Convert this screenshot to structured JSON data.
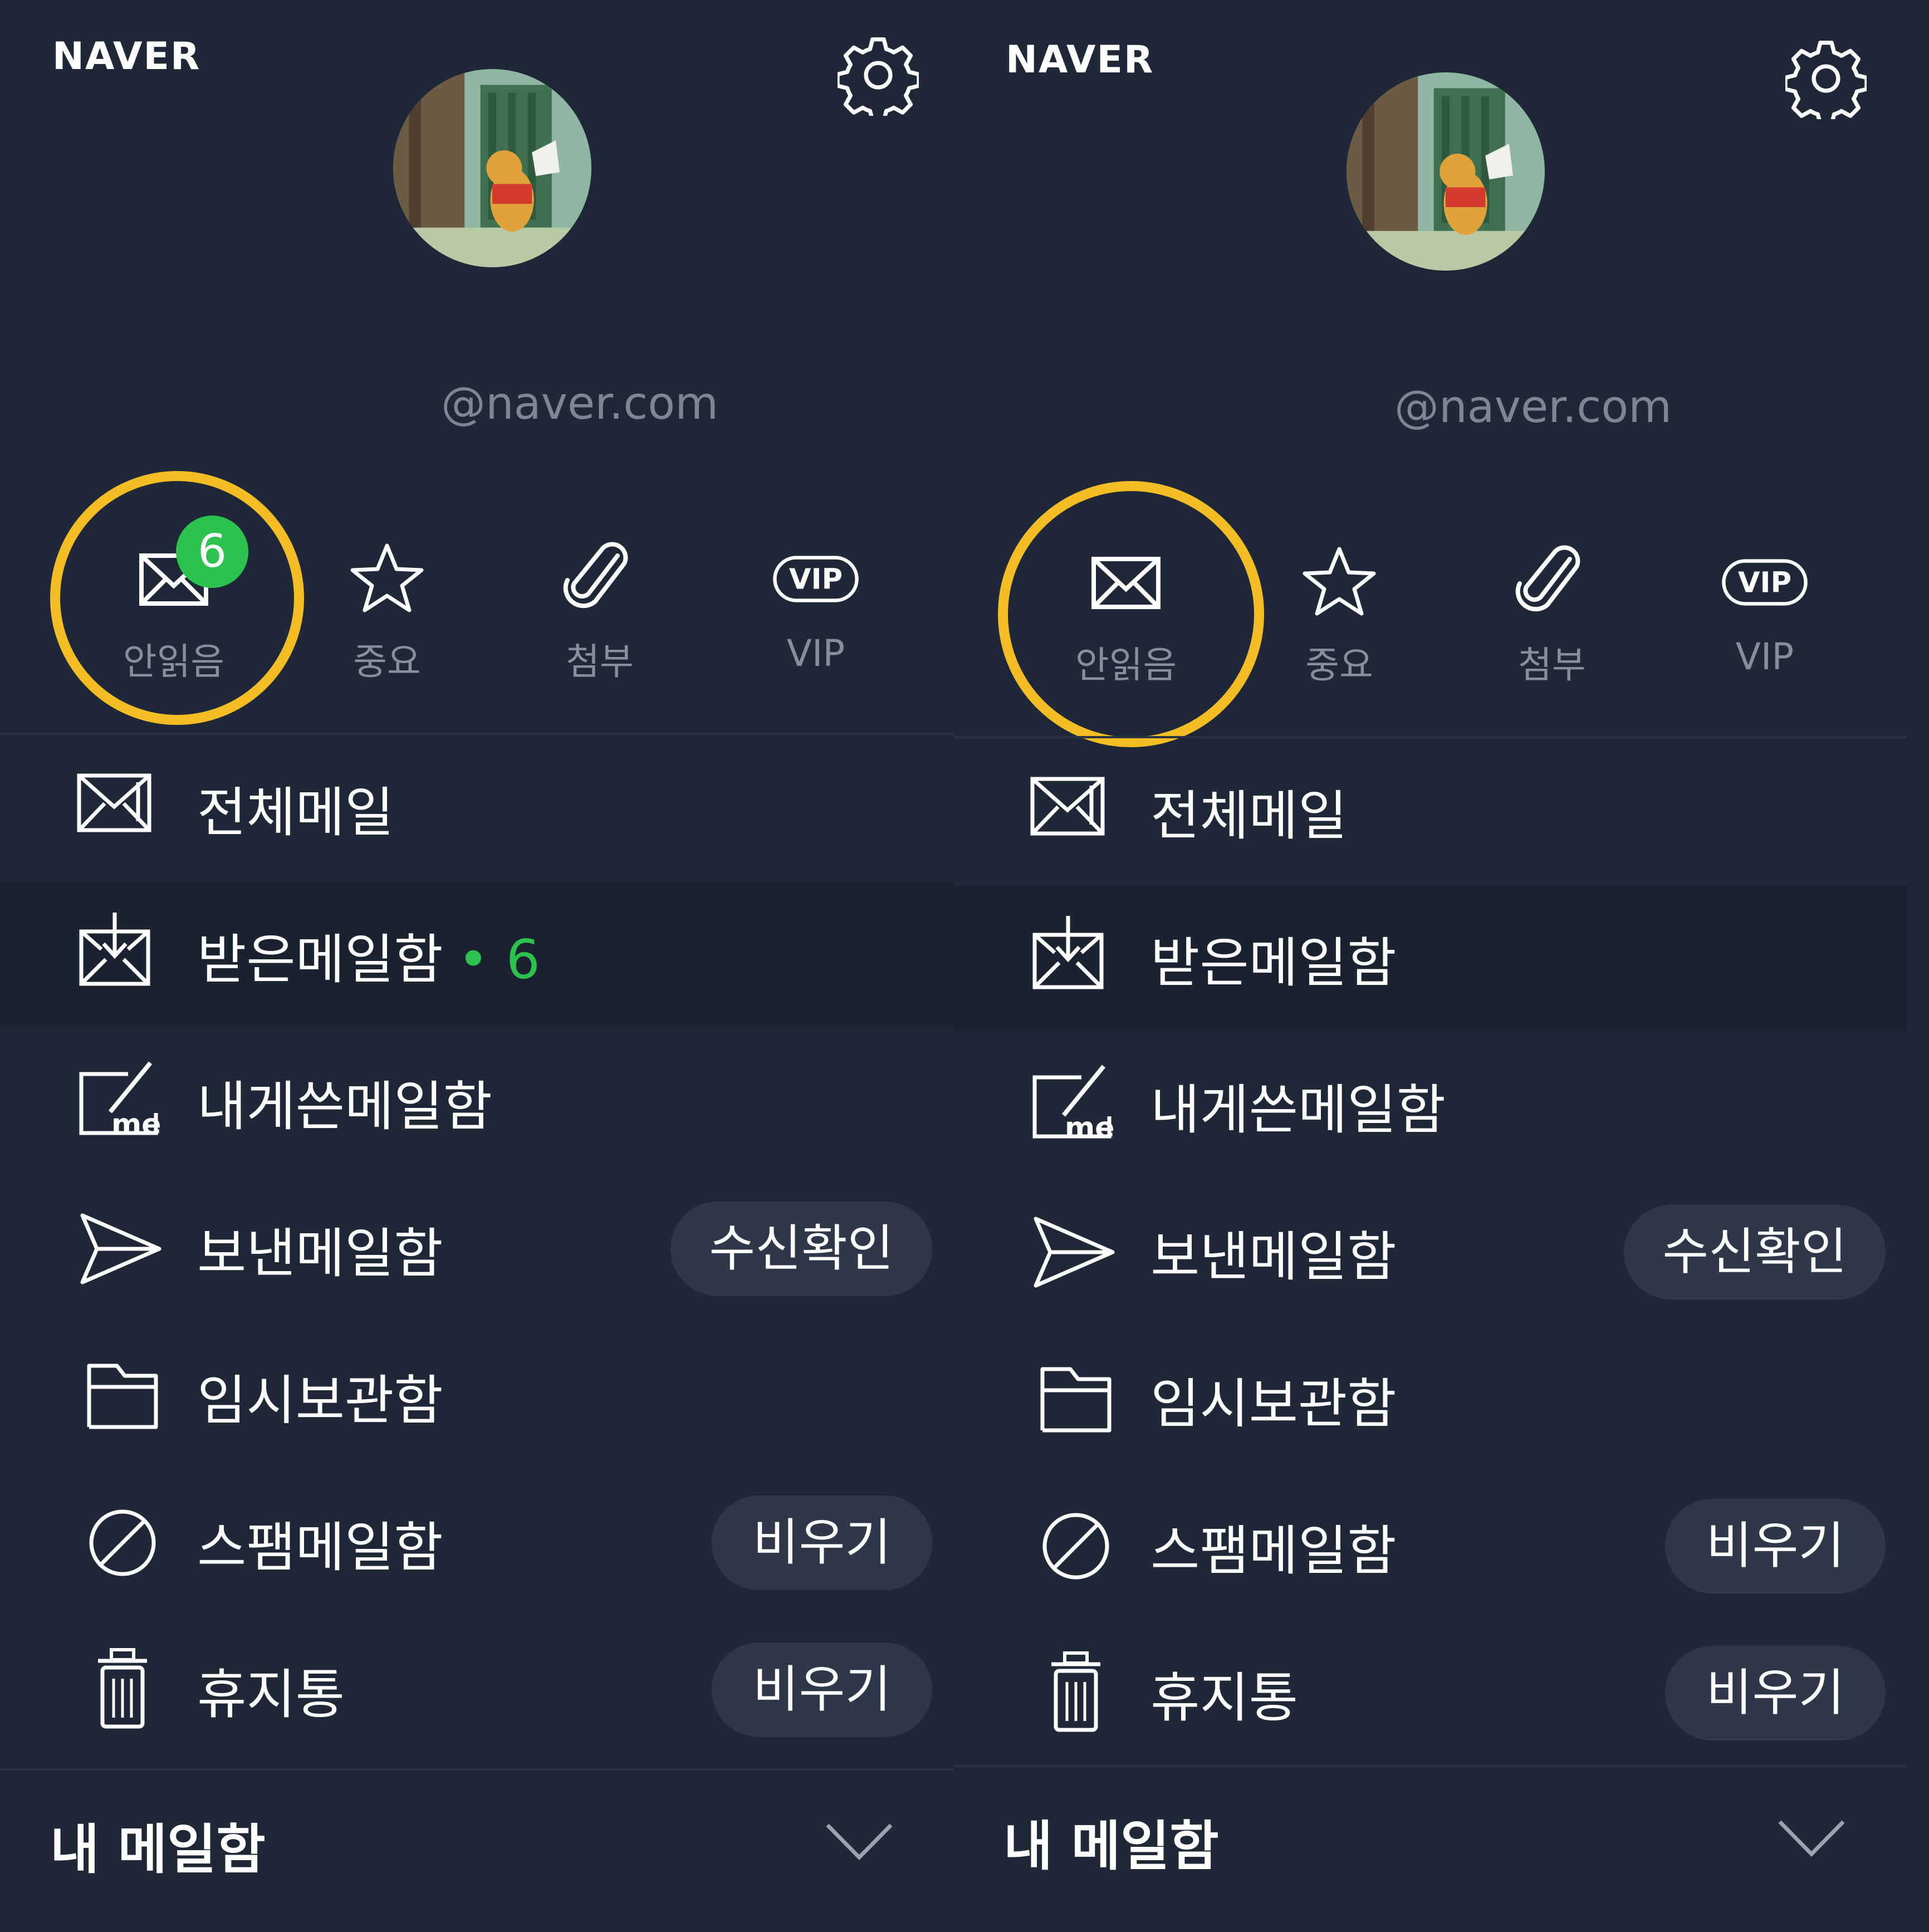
{
  "screens": [
    {
      "logo": "NAVER",
      "email": "@naver.com",
      "quick": [
        {
          "label": "안읽음",
          "icon": "envelope-icon"
        },
        {
          "label": "중요",
          "icon": "star-icon"
        },
        {
          "label": "첨부",
          "icon": "paperclip-icon"
        },
        {
          "label": "VIP",
          "icon": "vip-icon"
        }
      ],
      "unread_badge": "6",
      "menu": [
        {
          "label": "전체메일",
          "icon": "all-mail-icon"
        },
        {
          "label": "받은메일함",
          "icon": "inbox-icon",
          "dot": "•",
          "count": "6",
          "selected": true
        },
        {
          "label": "내게쓴메일함",
          "icon": "to-me-icon"
        },
        {
          "label": "보낸메일함",
          "icon": "send-icon",
          "action": "수신확인"
        },
        {
          "label": "임시보관함",
          "icon": "folder-icon"
        },
        {
          "label": "스팸메일함",
          "icon": "spam-icon",
          "action": "비우기"
        },
        {
          "label": "휴지통",
          "icon": "trash-icon",
          "action": "비우기"
        }
      ],
      "my_mailbox": "내 메일함"
    },
    {
      "logo": "NAVER",
      "email": "@naver.com",
      "quick": [
        {
          "label": "안읽음",
          "icon": "envelope-icon"
        },
        {
          "label": "중요",
          "icon": "star-icon"
        },
        {
          "label": "첨부",
          "icon": "paperclip-icon"
        },
        {
          "label": "VIP",
          "icon": "vip-icon"
        }
      ],
      "menu": [
        {
          "label": "전체메일",
          "icon": "all-mail-icon"
        },
        {
          "label": "받은메일함",
          "icon": "inbox-icon",
          "selected": true
        },
        {
          "label": "내게쓴메일함",
          "icon": "to-me-icon"
        },
        {
          "label": "보낸메일함",
          "icon": "send-icon",
          "action": "수신확인"
        },
        {
          "label": "임시보관함",
          "icon": "folder-icon"
        },
        {
          "label": "스팸메일함",
          "icon": "spam-icon",
          "action": "비우기"
        },
        {
          "label": "휴지통",
          "icon": "trash-icon",
          "action": "비우기"
        }
      ],
      "my_mailbox": "내 메일함"
    }
  ],
  "colors": {
    "background": "#1f2836",
    "highlight_ring": "#f4bd24",
    "badge_green": "#2bc24e",
    "pill": "#2e3848",
    "muted_text": "#868f9b"
  }
}
